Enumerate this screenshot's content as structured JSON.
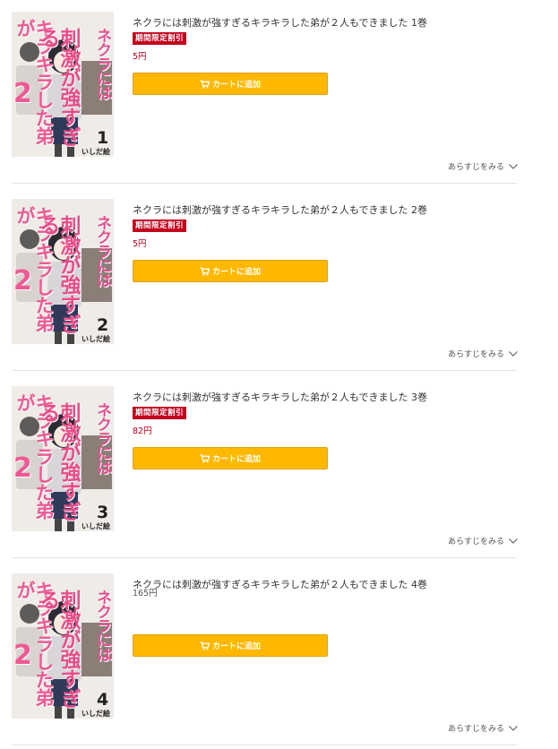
{
  "items": [
    {
      "title": "ネクラには刺激が強すぎるキラキラした弟が２人もできました 1巻",
      "badge": "期間限定割引",
      "price": "5円",
      "cart_label": "カートに追加",
      "synopsis_label": "あらすじをみる",
      "cover": {
        "title_a": "キラキラした弟が",
        "title_b": "刺激が強すぎる",
        "title_c": "ネクラには",
        "big_two": "2",
        "title_d": "人もできました",
        "volume": "1",
        "author": "いしだ絵里"
      }
    },
    {
      "title": "ネクラには刺激が強すぎるキラキラした弟が２人もできました 2巻",
      "badge": "期間限定割引",
      "price": "5円",
      "cart_label": "カートに追加",
      "synopsis_label": "あらすじをみる",
      "cover": {
        "title_a": "キラキラした弟が",
        "title_b": "刺激が強すぎる",
        "title_c": "ネクラには",
        "big_two": "2",
        "title_d": "人もできました",
        "volume": "2",
        "author": "いしだ絵里"
      }
    },
    {
      "title": "ネクラには刺激が強すぎるキラキラした弟が２人もできました 3巻",
      "badge": "期間限定割引",
      "price": "82円",
      "cart_label": "カートに追加",
      "synopsis_label": "あらすじをみる",
      "cover": {
        "title_a": "キラキラした弟が",
        "title_b": "刺激が強すぎる",
        "title_c": "ネクラには",
        "big_two": "2",
        "title_d": "人もできました",
        "volume": "3",
        "author": "いしだ絵里"
      }
    },
    {
      "title": "ネクラには刺激が強すぎるキラキラした弟が２人もできました 4巻",
      "badge": "",
      "price": "165円",
      "cart_label": "カートに追加",
      "synopsis_label": "あらすじをみる",
      "cover": {
        "title_a": "キラキラした弟が",
        "title_b": "刺激が強すぎる",
        "title_c": "ネクラには",
        "big_two": "2",
        "title_d": "人もできました",
        "volume": "4",
        "author": "いしだ絵里"
      }
    }
  ],
  "colors": {
    "cart_button": "#ffb800",
    "badge": "#c4001c",
    "sale_price": "#b5001a",
    "cover_title_pink": "#ea4c8a"
  },
  "icons": {
    "cart": "cart-icon",
    "expand": "chevron-down-icon"
  }
}
